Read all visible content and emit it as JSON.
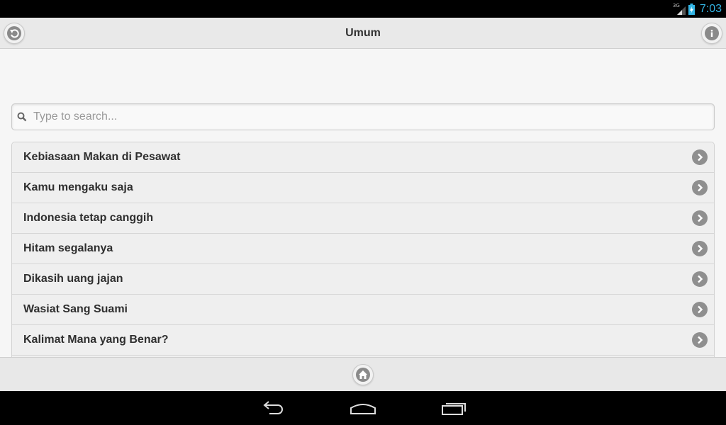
{
  "status_bar": {
    "network": "3G",
    "time": "7:03"
  },
  "header": {
    "title": "Umum",
    "back_icon": "back-arrow-icon",
    "info_icon": "info-icon"
  },
  "search": {
    "placeholder": "Type to search...",
    "value": ""
  },
  "list": {
    "items": [
      {
        "label": "Kebiasaan Makan di Pesawat"
      },
      {
        "label": "Kamu mengaku saja"
      },
      {
        "label": "Indonesia tetap canggih"
      },
      {
        "label": "Hitam segalanya"
      },
      {
        "label": "Dikasih uang jajan"
      },
      {
        "label": "Wasiat Sang Suami"
      },
      {
        "label": "Kalimat Mana yang Benar?"
      },
      {
        "label": ""
      }
    ]
  },
  "footer": {
    "home_icon": "home-icon"
  },
  "navbar": {
    "icons": [
      "nav-back-icon",
      "nav-home-icon",
      "nav-recents-icon"
    ]
  },
  "colors": {
    "accent_clock": "#33b5e5",
    "header_bg": "#e9e9e9",
    "list_bg": "#efefef",
    "icon_gray": "#8f8f8f"
  }
}
